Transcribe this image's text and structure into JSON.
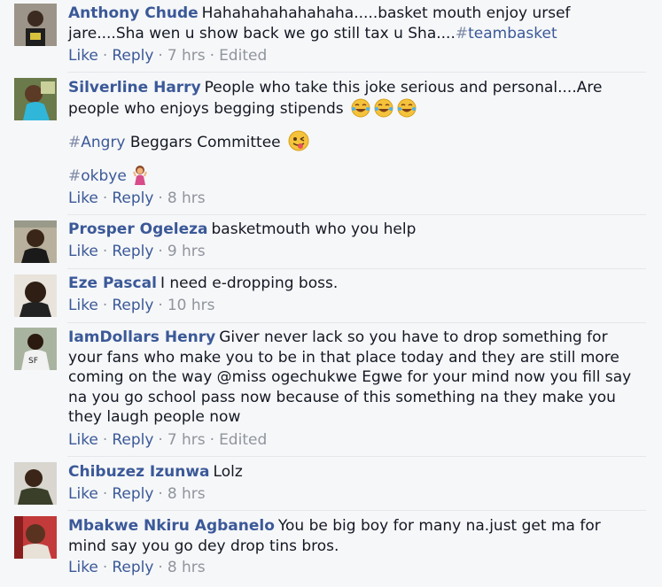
{
  "comments": [
    {
      "author": "Anthony Chude",
      "text": "Hahahahahahahaha.....basket mouth enjoy ursef jare....Sha wen u show back we go still tax u Sha....",
      "hashtag": "teambasket",
      "like": "Like",
      "reply": "Reply",
      "time": "7 hrs",
      "edited": "Edited"
    },
    {
      "author": "Silverline Harry",
      "text": "People who take this joke serious and personal....Are people who enjoys begging stipends",
      "line2_hashtag": "Angry",
      "line2_text": "Beggars Committee",
      "line3_hashtag": "okbye",
      "emoji_laugh": "tears-of-joy-emoji",
      "emoji_wink": "winking-tongue-emoji",
      "emoji_girl": "woman-gesturing-emoji",
      "like": "Like",
      "reply": "Reply",
      "time": "8 hrs"
    },
    {
      "author": "Prosper Ogeleza",
      "text": "basketmouth who you help",
      "like": "Like",
      "reply": "Reply",
      "time": "9 hrs"
    },
    {
      "author": "Eze Pascal",
      "text": "I need e-dropping boss.",
      "like": "Like",
      "reply": "Reply",
      "time": "10 hrs"
    },
    {
      "author": "IamDollars Henry",
      "text": "Giver never lack so you have to drop something for your fans who make you to be in that place today and they are still more coming on the way @miss ogechukwe Egwe for your mind now you fill say na you go school pass now because of this something na they make you they laugh people now",
      "like": "Like",
      "reply": "Reply",
      "time": "7 hrs",
      "edited": "Edited"
    },
    {
      "author": "Chibuzez Izunwa",
      "text": "Lolz",
      "like": "Like",
      "reply": "Reply",
      "time": "8 hrs"
    },
    {
      "author": "Mbakwe Nkiru Agbanelo",
      "text": "You be big boy for many na.just get ma for mind say you go dey drop tins bros.",
      "like": "Like",
      "reply": "Reply",
      "time": "8 hrs"
    }
  ],
  "colors": {
    "link": "#3b5998",
    "meta": "#90949c",
    "background": "#f6f7f9"
  }
}
